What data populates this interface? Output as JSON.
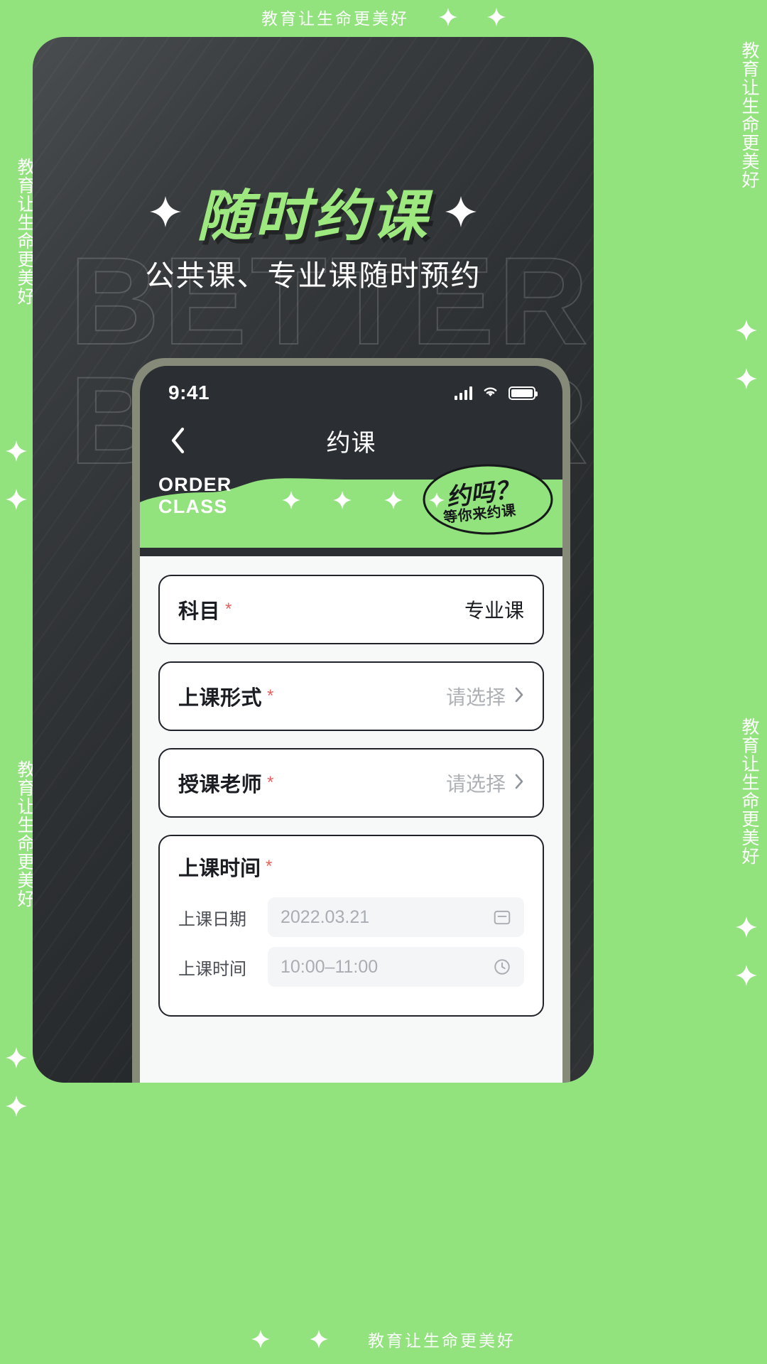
{
  "brand": {
    "slogan": "教育让生命更美好",
    "accent_green": "#92e27e",
    "poster_green": "#9de87f",
    "dark": "#2b2e33",
    "required_red": "#e8615c"
  },
  "poster": {
    "title": "随时约课",
    "subtitle": "公共课、专业课随时预约",
    "ghost_line_1": "BETTER",
    "ghost_line_2": "BETTER"
  },
  "phone": {
    "status": {
      "time": "9:41",
      "signal_icon": "signal-bars-icon",
      "wifi_icon": "wifi-icon",
      "battery_icon": "battery-icon"
    },
    "nav": {
      "back_icon": "chevron-left-icon",
      "title": "约课"
    },
    "hero": {
      "order_line_1": "ORDER",
      "order_line_2": "CLASS",
      "bubble_line_1": "约吗？",
      "bubble_line_2": "等你来约课",
      "star_icon": "four-point-star-icon"
    },
    "form": {
      "fields": [
        {
          "label": "科目",
          "required": "*",
          "value": "专业课",
          "is_placeholder": false,
          "has_chevron": false
        },
        {
          "label": "上课形式",
          "required": "*",
          "value": "请选择",
          "is_placeholder": true,
          "has_chevron": true
        },
        {
          "label": "授课老师",
          "required": "*",
          "value": "请选择",
          "is_placeholder": true,
          "has_chevron": true
        }
      ],
      "time_block": {
        "title": "上课时间",
        "required": "*",
        "rows": [
          {
            "label": "上课日期",
            "value": "2022.03.21",
            "icon": "calendar-icon"
          },
          {
            "label": "上课时间",
            "value": "10:00–11:00",
            "icon": "clock-icon"
          }
        ]
      }
    }
  },
  "decor": {
    "top_slogan": "教育让生命更美好",
    "bottom_slogan": "教育让生命更美好",
    "side_slogan": "教育让生命更美好",
    "star_icon": "four-point-star-icon"
  }
}
